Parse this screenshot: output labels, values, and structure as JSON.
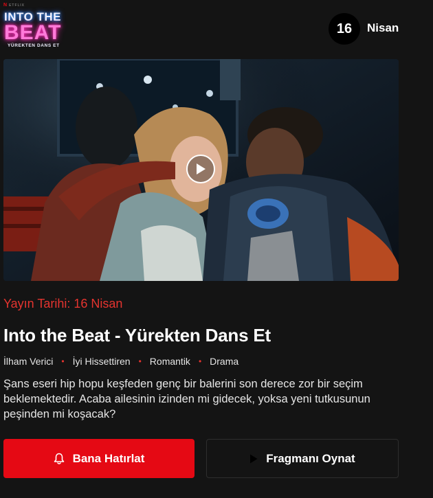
{
  "header": {
    "brand_letter": "N",
    "brand_sub": "ETFLIX",
    "logo_line1": "INTO THE",
    "logo_line2": "BEAT",
    "logo_line3": "YÜREKTEN DANS ET",
    "date_day": "16",
    "date_month": "Nisan"
  },
  "video": {
    "play_icon": "play-icon"
  },
  "info": {
    "release_label": "Yayın Tarihi: 16 Nisan",
    "title": "Into the Beat - Yürekten Dans Et",
    "tags": [
      "İlham Verici",
      "İyi Hissettiren",
      "Romantik",
      "Drama"
    ],
    "description": "Şans eseri hip hopu keşfeden genç bir balerini son derece zor bir seçim beklemektedir. Acaba ailesinin izinden mi gidecek, yoksa yeni tutkusunun peşinden mi koşacak?"
  },
  "buttons": {
    "remind_label": "Bana Hatırlat",
    "remind_icon": "bell-icon",
    "trailer_label": "Fragmanı Oynat",
    "trailer_icon": "play-icon"
  },
  "colors": {
    "background": "#141414",
    "accent_red": "#e50914",
    "release_red": "#e5342f",
    "text": "#ffffff"
  }
}
